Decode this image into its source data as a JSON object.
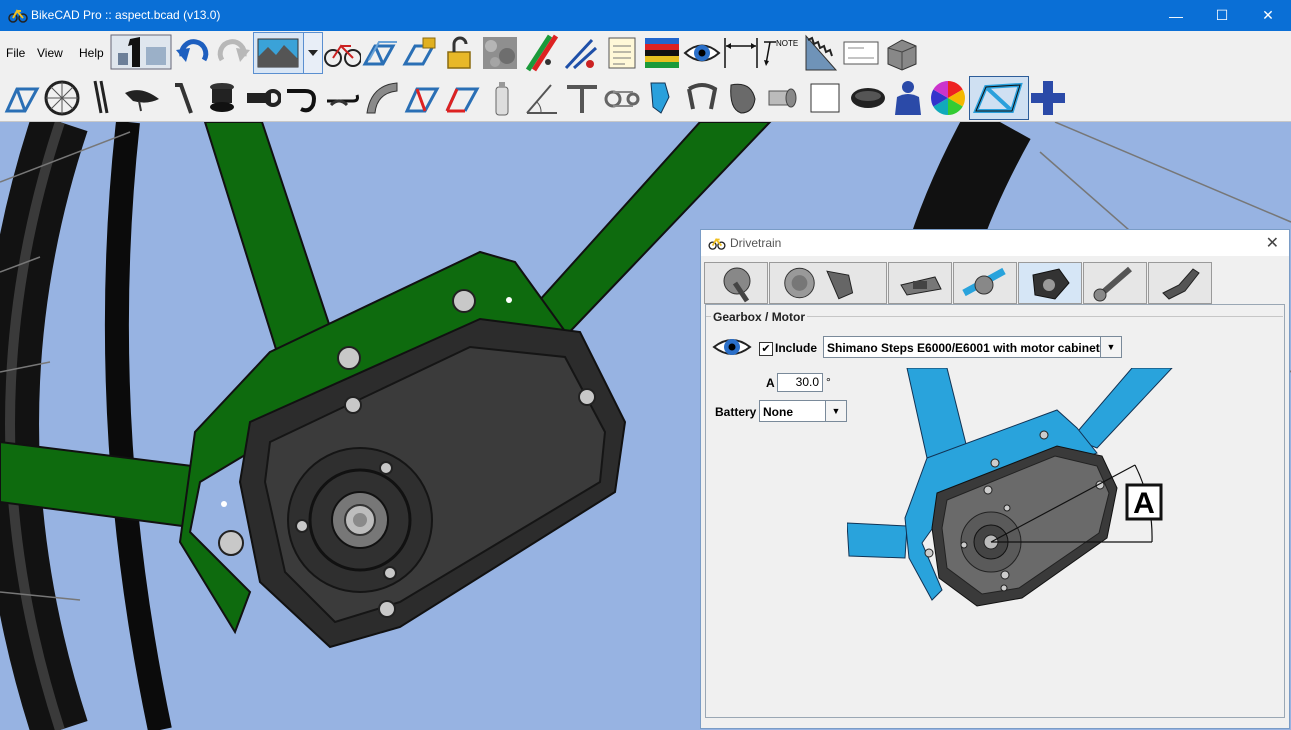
{
  "window": {
    "title": "BikeCAD Pro :: aspect.bcad (v13.0)",
    "controls": {
      "minimize": "—",
      "maximize": "☐",
      "close": "✕"
    }
  },
  "menu": {
    "items": [
      {
        "label": "File"
      },
      {
        "label": "View"
      },
      {
        "label": "Help"
      }
    ]
  },
  "toolbar": {
    "row1_icons": [
      "bikecad-one-icon",
      "undo-icon",
      "redo-icon",
      "background-icon",
      "dropdown-icon",
      "bike-compare-icon",
      "frame-copy-icon",
      "lock-icon",
      "unlock-icon",
      "stone-texture-icon",
      "dimension-tool-icon",
      "caliper-icon",
      "notepad-icon",
      "world-champion-icon",
      "eye-icon",
      "dimension-arrow-icon",
      "note-arrow-icon",
      "chainring-teeth-icon",
      "frame-dimensions-icon",
      "block-icon"
    ],
    "row2_icons": [
      "frame-icon",
      "wheel-icon",
      "fork-icon",
      "saddle-icon",
      "seatpost-icon",
      "headset-icon",
      "stem-icon",
      "handlebar-icon",
      "aero-bar-icon",
      "fender-icon",
      "frame-red-icon",
      "frame-red2-icon",
      "bottle-icon",
      "angle-icon",
      "tube-join-icon",
      "drivetrain-icon",
      "derailleur-icon",
      "brake-icon",
      "bag-icon",
      "hub-icon",
      "blank-icon",
      "saddle-bag-icon",
      "rider-icon",
      "color-wheel-icon",
      "frame-selected-icon",
      "add-icon"
    ]
  },
  "dialog": {
    "title": "Drivetrain",
    "close": "✕",
    "tabs": [
      "crankset-tab",
      "cassette-tab",
      "pedal-tab",
      "chainring-tab",
      "gearbox-tab",
      "crank-arm-tab",
      "shifter-tab"
    ],
    "selected_tab_index": 4,
    "group_title": "Gearbox / Motor",
    "include": {
      "label": "Include",
      "checked": true,
      "check_glyph": "✔"
    },
    "motor_select": {
      "value": "Shimano Steps E6000/E6001 with motor cabinet"
    },
    "angle": {
      "label": "A",
      "value": "30.0",
      "unit": "°"
    },
    "battery": {
      "label": "Battery",
      "value": "None"
    },
    "preview_label": "A"
  },
  "colors": {
    "titlebar": "#0a6fd6",
    "canvas_bg": "#97b3e2",
    "frame_green": "#0e6b0e",
    "motor_gray": "#3a3a3a",
    "preview_blue": "#29a3dc"
  }
}
